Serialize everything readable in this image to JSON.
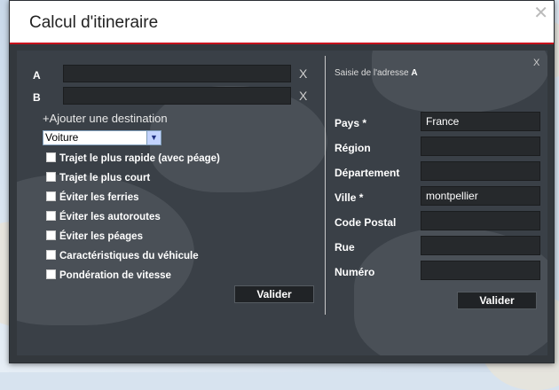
{
  "dialog": {
    "title": "Calcul d'itineraire",
    "close_glyph": "✕"
  },
  "route": {
    "a_label": "A",
    "b_label": "B",
    "a_value": "",
    "b_value": "",
    "clear_glyph": "X",
    "add_destination": "+Ajouter une destination",
    "mode_selected": "Voiture",
    "options": [
      "Trajet le plus rapide (avec péage)",
      "Trajet le plus court",
      "Éviter les ferries",
      "Éviter les autoroutes",
      "Éviter les péages",
      "Caractéristiques du véhicule",
      "Pondération de vitesse"
    ],
    "submit_label": "Valider"
  },
  "address": {
    "heading_prefix": "Saisie de l'adresse",
    "heading_point": "A",
    "close_glyph": "X",
    "fields": [
      {
        "label": "Pays *",
        "value": "France"
      },
      {
        "label": "Région",
        "value": ""
      },
      {
        "label": "Département",
        "value": ""
      },
      {
        "label": "Ville *",
        "value": "montpellier"
      },
      {
        "label": "Code Postal",
        "value": ""
      },
      {
        "label": "Rue",
        "value": ""
      },
      {
        "label": "Numéro",
        "value": ""
      }
    ],
    "submit_label": "Valider"
  }
}
